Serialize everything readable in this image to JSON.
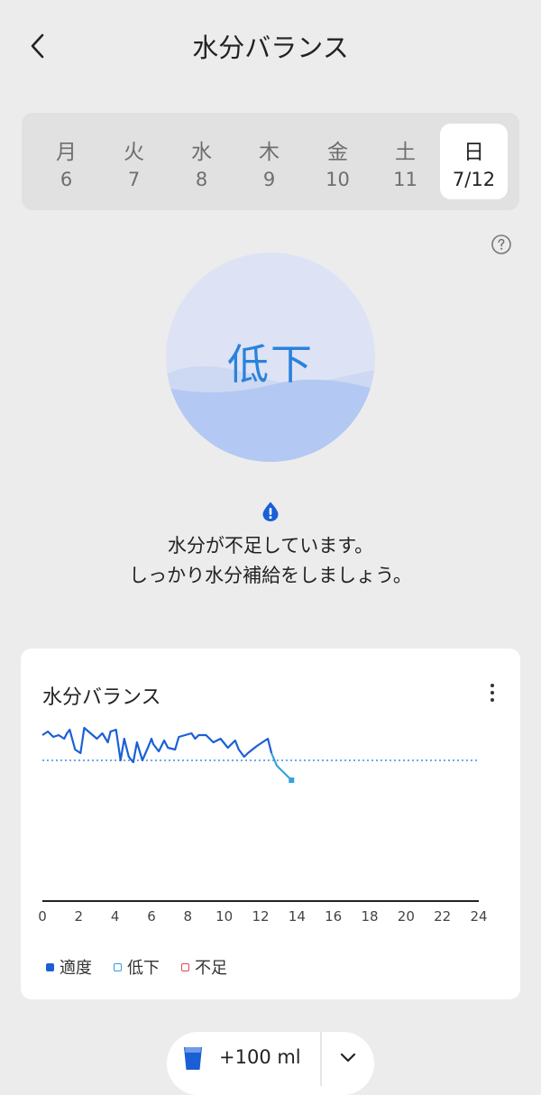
{
  "header": {
    "title": "水分バランス",
    "back_icon": "chevron-left-icon"
  },
  "week": {
    "days": [
      {
        "weekday": "月",
        "date": "6",
        "selected": false
      },
      {
        "weekday": "火",
        "date": "7",
        "selected": false
      },
      {
        "weekday": "水",
        "date": "8",
        "selected": false
      },
      {
        "weekday": "木",
        "date": "9",
        "selected": false
      },
      {
        "weekday": "金",
        "date": "10",
        "selected": false
      },
      {
        "weekday": "土",
        "date": "11",
        "selected": false
      },
      {
        "weekday": "日",
        "date": "7/12",
        "selected": true
      }
    ]
  },
  "help_icon": "question-circle-icon",
  "status": {
    "label": "低下",
    "label_color": "#2a82dc",
    "alert_icon": "exclamation-drop-icon",
    "message_line1": "水分が不足しています。",
    "message_line2": "しっかり水分補給をしましょう。"
  },
  "card": {
    "title": "水分バランス",
    "menu_icon": "more-vertical-icon"
  },
  "chart_data": {
    "type": "line",
    "x_ticks": [
      "0",
      "2",
      "4",
      "6",
      "8",
      "10",
      "12",
      "14",
      "16",
      "18",
      "20",
      "22",
      "24"
    ],
    "xlim": [
      0,
      24
    ],
    "x": [
      0,
      0.3,
      0.6,
      0.9,
      1.2,
      1.35,
      1.5,
      1.8,
      2.1,
      2.3,
      3.0,
      3.3,
      3.6,
      3.75,
      4.05,
      4.3,
      4.5,
      4.75,
      5.0,
      5.2,
      5.5,
      5.8,
      6.0,
      6.1,
      6.4,
      6.7,
      6.9,
      7.3,
      7.5,
      8.2,
      8.4,
      8.6,
      9.0,
      9.4,
      9.8,
      10.2,
      10.6,
      10.8,
      11.1,
      11.3,
      11.55,
      11.8,
      12.1,
      12.4,
      12.6,
      12.9,
      13.2,
      13.5,
      13.7
    ],
    "y": [
      0.7,
      0.8,
      0.65,
      0.7,
      0.6,
      0.75,
      0.85,
      0.3,
      0.2,
      0.9,
      0.6,
      0.75,
      0.5,
      0.8,
      0.85,
      0.0,
      0.6,
      0.1,
      -0.05,
      0.5,
      0.0,
      0.35,
      0.6,
      0.45,
      0.25,
      0.55,
      0.35,
      0.3,
      0.65,
      0.75,
      0.6,
      0.7,
      0.7,
      0.5,
      0.6,
      0.35,
      0.55,
      0.3,
      0.1,
      0.2,
      0.3,
      0.4,
      0.5,
      0.6,
      0.2,
      -0.15,
      -0.3,
      -0.45,
      -0.55
    ],
    "series_colors": {
      "適度": "#1a5fd6",
      "低下": "#35a2e0"
    },
    "reference_line": 0,
    "grid": false,
    "legend": [
      {
        "label": "適度",
        "color": "#1a5fd6",
        "style": "filled"
      },
      {
        "label": "低下",
        "color": "#2f9be0",
        "style": "outline"
      },
      {
        "label": "不足",
        "color": "#e0445a",
        "style": "outline"
      }
    ]
  },
  "add_water": {
    "label": "+100 ml",
    "cup_icon": "water-cup-icon",
    "dropdown_icon": "chevron-down-icon",
    "accent": "#1a5fd6"
  }
}
